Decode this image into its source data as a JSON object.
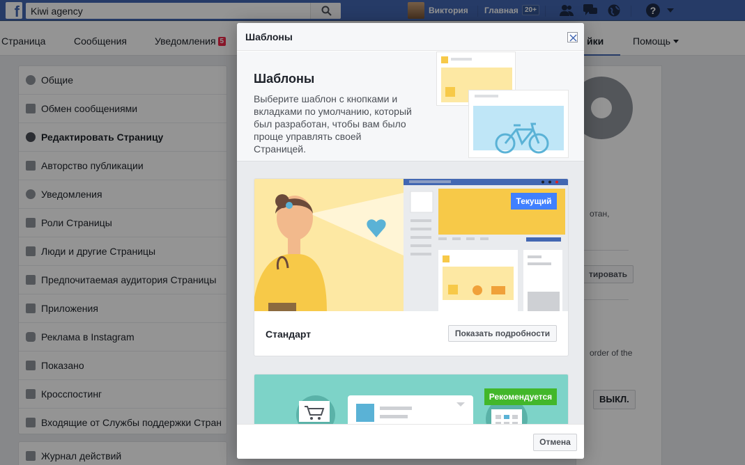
{
  "topbar": {
    "logo": "f",
    "search_value": "Kiwi agency",
    "user_name": "Виктория",
    "home_label": "Главная",
    "home_badge": "20+",
    "help_label": "?"
  },
  "tabs": {
    "page": "Страница",
    "messages": "Сообщения",
    "notifications": "Уведомления",
    "notifications_badge": "5",
    "settings_partial": "йки",
    "help": "Помощь"
  },
  "sidebar": {
    "items": [
      {
        "label": "Общие",
        "icon": "gear-icon"
      },
      {
        "label": "Обмен сообщениями",
        "icon": "chat-icon"
      },
      {
        "label": "Редактировать Страницу",
        "icon": "gear-icon"
      },
      {
        "label": "Авторство публикации",
        "icon": "flag-icon"
      },
      {
        "label": "Уведомления",
        "icon": "globe-icon"
      },
      {
        "label": "Роли Страницы",
        "icon": "person-icon"
      },
      {
        "label": "Люди и другие Страницы",
        "icon": "people-icon"
      },
      {
        "label": "Предпочитаемая аудитория Страницы",
        "icon": "people-icon"
      },
      {
        "label": "Приложения",
        "icon": "cube-icon"
      },
      {
        "label": "Реклама в Instagram",
        "icon": "instagram-icon"
      },
      {
        "label": "Показано",
        "icon": "star-icon"
      },
      {
        "label": "Кросспостинг",
        "icon": "video-icon"
      },
      {
        "label": "Входящие от Службы поддержки Стран",
        "icon": "facebook-icon"
      }
    ],
    "activity_log": "Журнал действий"
  },
  "right_panel": {
    "text1": "отан,",
    "btn1": "тировать",
    "text2": "order of the",
    "btn2": "ВЫКЛ."
  },
  "modal": {
    "title": "Шаблоны",
    "intro_title": "Шаблоны",
    "intro_desc": "Выберите шаблон с кнопками и вкладками по умолчанию, который был разработан, чтобы вам было проще управлять своей Страницей.",
    "templates": [
      {
        "name": "Стандарт",
        "badge": "Текущий",
        "button": "Показать подробности"
      },
      {
        "badge": "Рекомендуется"
      }
    ],
    "cancel": "Отмена"
  },
  "colors": {
    "brand": "#4267b2",
    "current_badge": "#4080ff",
    "recommended_badge": "#42b72a",
    "illustration_yellow": "#f7c948",
    "illustration_teal": "#7dd3c8"
  }
}
